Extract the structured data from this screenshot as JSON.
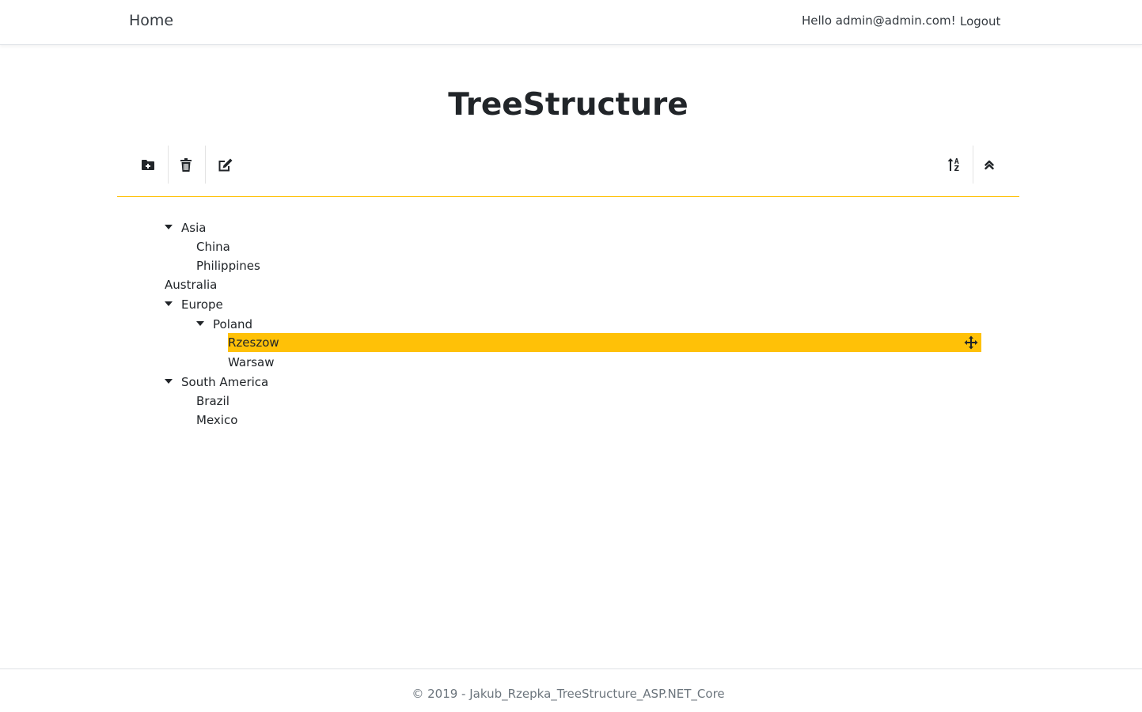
{
  "navbar": {
    "brand": "Home",
    "greeting": "Hello admin@admin.com!",
    "logout": "Logout"
  },
  "page": {
    "title": "TreeStructure"
  },
  "toolbar": {
    "left_icons": [
      "folder-plus-icon",
      "trash-icon",
      "edit-icon"
    ],
    "right_icons": [
      "sort-alpha-icon",
      "collapse-all-icon"
    ]
  },
  "tree": {
    "nodes": [
      {
        "label": "Asia",
        "level": 0,
        "expanded": true
      },
      {
        "label": "China",
        "level": 1
      },
      {
        "label": "Philippines",
        "level": 1
      },
      {
        "label": "Australia",
        "level": 0
      },
      {
        "label": "Europe",
        "level": 0,
        "expanded": true
      },
      {
        "label": "Poland",
        "level": 1,
        "expanded": true
      },
      {
        "label": "Rzeszow",
        "level": 2,
        "selected": true
      },
      {
        "label": "Warsaw",
        "level": 2
      },
      {
        "label": "South America",
        "level": 0,
        "expanded": true
      },
      {
        "label": "Brazil",
        "level": 1
      },
      {
        "label": "Mexico",
        "level": 1
      }
    ]
  },
  "footer": {
    "text": "© 2019 - Jakub_Rzepka_TreeStructure_ASP.NET_Core"
  },
  "colors": {
    "accent": "#ffc107",
    "text": "#212529",
    "muted": "#6c757d"
  }
}
